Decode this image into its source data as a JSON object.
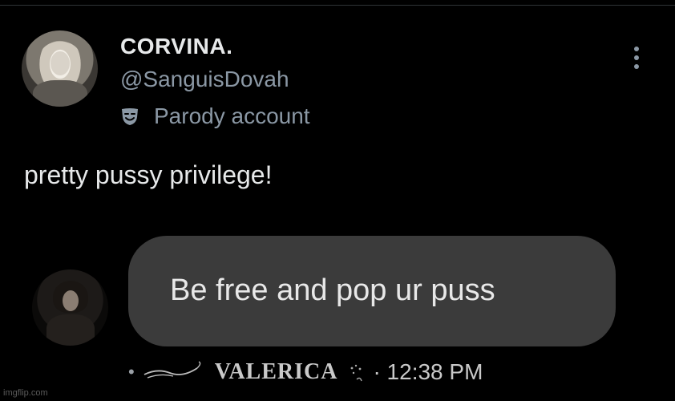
{
  "post": {
    "display_name": "CORVINA.",
    "handle": "@SanguisDovah",
    "parody_label": "Parody account",
    "text": "pretty pussy privilege!"
  },
  "message": {
    "text": "Be free and pop ur puss",
    "separator": "•",
    "sender": "VALERICA",
    "time": "· 12:38 PM"
  },
  "icons": {
    "parody": "theater-masks-icon",
    "more": "more-vertical-icon"
  },
  "colors": {
    "background": "#000000",
    "primary_text": "#e7e9ea",
    "secondary_text": "#8b98a5",
    "bubble": "#3b3b3b"
  },
  "watermark": "imgflip.com"
}
